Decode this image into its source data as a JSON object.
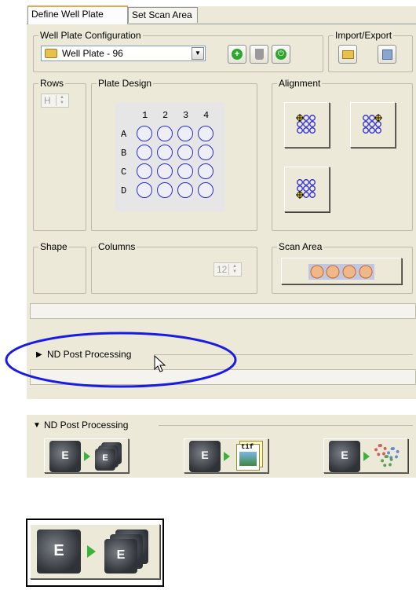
{
  "tabs": [
    {
      "label": "Define Well Plate"
    },
    {
      "label": "Set Scan Area"
    }
  ],
  "groups": {
    "config": "Well Plate Configuration",
    "import_export": "Import/Export",
    "rows": "Rows",
    "plate_design": "Plate Design",
    "alignment": "Alignment",
    "shape": "Shape",
    "columns": "Columns",
    "scan_area": "Scan Area"
  },
  "config": {
    "selected": "Well Plate - 96"
  },
  "rows_value": "H",
  "columns_value": "12",
  "plate": {
    "col_labels": [
      "1",
      "2",
      "3",
      "4"
    ],
    "row_labels": [
      "A",
      "B",
      "C",
      "D"
    ]
  },
  "nd_post_processing": "ND Post Processing",
  "colors": {
    "panel": "#ece9d8",
    "well_outline": "#2b2bd0",
    "highlight_ellipse": "#1a1ae6"
  }
}
